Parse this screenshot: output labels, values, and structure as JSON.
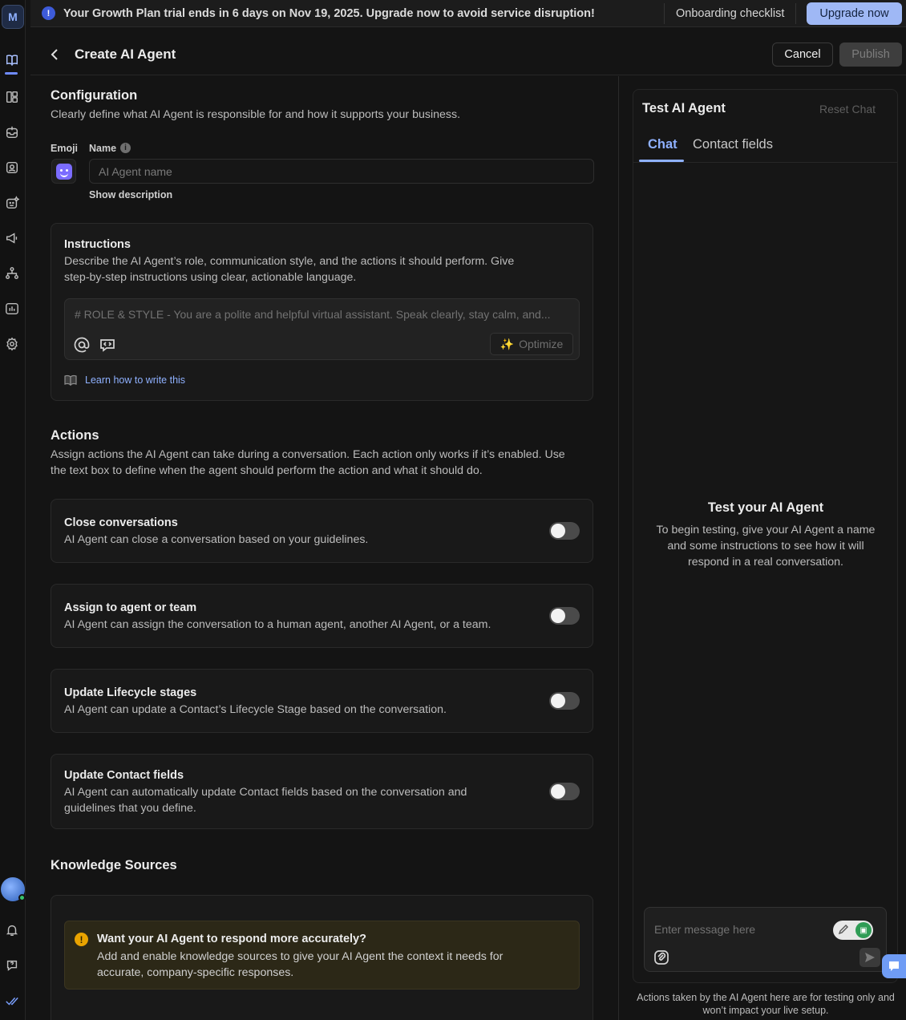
{
  "rail": {
    "logo_letter": "M",
    "icons": [
      "book-icon",
      "layout-icon",
      "inbox-icon",
      "contacts-icon",
      "ai-agent-icon",
      "megaphone-icon",
      "workflow-icon",
      "reports-icon",
      "settings-icon",
      "notification-bell-icon",
      "help-icon",
      "checks-icon"
    ]
  },
  "banner": {
    "message": "Your Growth Plan trial ends in 6 days on Nov 19, 2025. Upgrade now to avoid service disruption!",
    "onboarding_label": "Onboarding checklist",
    "upgrade_label": "Upgrade now"
  },
  "header": {
    "title": "Create AI Agent",
    "cancel_label": "Cancel",
    "publish_label": "Publish"
  },
  "configuration": {
    "title": "Configuration",
    "description": "Clearly define what AI Agent is responsible for and how it supports your business.",
    "emoji_label": "Emoji",
    "name_label": "Name",
    "name_placeholder": "AI Agent name",
    "show_description": "Show description"
  },
  "instructions": {
    "title": "Instructions",
    "description_line1": "Describe the AI Agent’s role, communication style, and the actions it should perform. Give",
    "description_line2": "step-by-step instructions using clear, actionable language.",
    "placeholder": "# ROLE & STYLE - You are a polite and helpful virtual assistant. Speak clearly, stay calm, and...",
    "optimize_label": "Optimize",
    "learn_link": "Learn how to write this"
  },
  "actions": {
    "title": "Actions",
    "description_line1": "Assign actions the AI Agent can take during a conversation. Each action only works if it’s enabled. Use",
    "description_line2": "the text box to define when the agent should perform the action and what it should do.",
    "items": [
      {
        "title": "Close conversations",
        "desc": "AI Agent can close a conversation based on your guidelines.",
        "enabled": false
      },
      {
        "title": "Assign to agent or team",
        "desc": "AI Agent can assign the conversation to a human agent, another AI Agent, or a team.",
        "enabled": false
      },
      {
        "title": "Update Lifecycle stages",
        "desc": "AI Agent can update a Contact’s Lifecycle Stage based on the conversation.",
        "enabled": false
      },
      {
        "title": "Update Contact fields",
        "desc_line1": "AI Agent can automatically update Contact fields based on the conversation and",
        "desc_line2": "guidelines that you define.",
        "enabled": false
      }
    ]
  },
  "knowledge": {
    "title": "Knowledge Sources",
    "warning_title": "Want your AI Agent to respond more accurately?",
    "warning_line1": "Add and enable knowledge sources to give your AI Agent the context it needs for",
    "warning_line2": "accurate, company-specific responses."
  },
  "test_panel": {
    "title": "Test AI Agent",
    "reset_label": "Reset Chat",
    "tabs": [
      "Chat",
      "Contact fields"
    ],
    "active_tab": "Chat",
    "empty_title": "Test your AI Agent",
    "empty_line1": "To begin testing, give your AI Agent a name",
    "empty_line2": "and some instructions to see how it will",
    "empty_line3": "respond in a real conversation.",
    "message_placeholder": "Enter message here",
    "footnote_line1": "Actions taken by the AI Agent here are for testing only and",
    "footnote_line2": "won’t impact your live setup."
  },
  "colors": {
    "accent": "#8fb1ff",
    "upgrade_button": "#9fb8f5",
    "warning": "#e9a300",
    "online": "#37c26b"
  }
}
